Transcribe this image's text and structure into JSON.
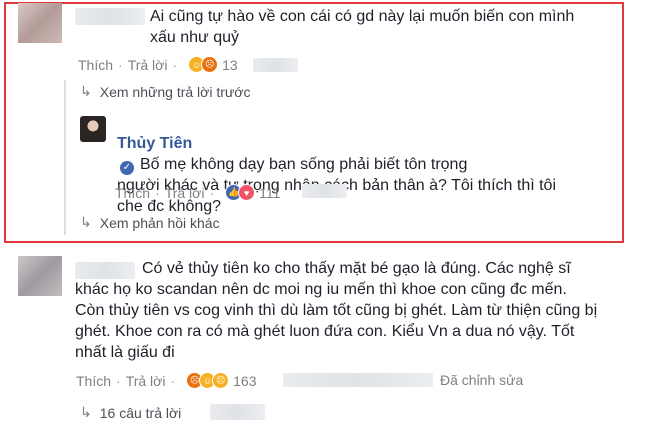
{
  "comment1": {
    "text": "Ai cũng tự hào về con cái có gd này lại muốn biến con mình\nxấu như quỷ",
    "like": "Thích",
    "reply": "Trả lời",
    "reaction_count": "13"
  },
  "thread1": {
    "prev_replies": "Xem những trả lời trước",
    "reply": {
      "name": "Thủy Tiên",
      "text": "Bố mẹ không dạy bạn sống phải biết tôn trọng\nngười khác và tự trọng nhân cách bản thân à? Tôi thích thì tôi\nche đc không?",
      "like": "Thích",
      "reply": "Trả lời",
      "reaction_count": "111"
    },
    "more_replies": "Xem phản hồi khác"
  },
  "comment2": {
    "text": "Có vẻ thủy tiên ko cho thấy mặt bé gạo là đúng. Các nghệ sĩ\nkhác họ ko scandan nên dc moi ng iu mến thì khoe con cũng đc mến.\nCòn thủy tiên vs cog vinh thì dù làm tốt cũng bị ghét. Làm từ thiện cũng bị\nghét. Khoe con ra có mà ghét luon đứa con. Kiểu Vn a dua nó vậy. Tốt\nnhất là giấu đi",
    "like": "Thích",
    "reply": "Trả lời",
    "reaction_count": "163",
    "edited": "Đã chỉnh sửa",
    "replies_link": "16 câu trả lời"
  },
  "colors": {
    "highlight_border": "#e0393e",
    "link": "#365899",
    "meta": "#7f7f7f"
  }
}
